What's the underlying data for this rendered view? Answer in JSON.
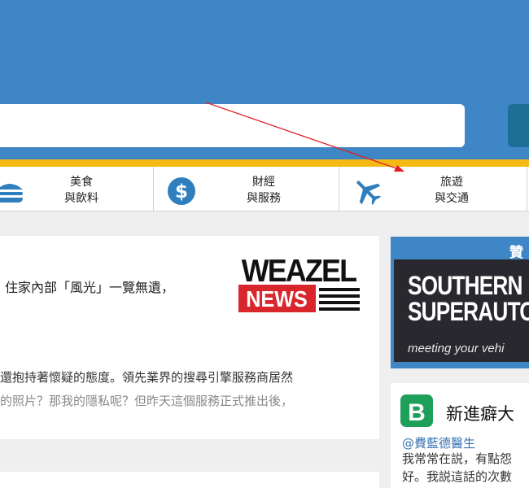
{
  "header": {
    "search": {
      "placeholder": "",
      "value": ""
    },
    "colors": {
      "header_bg": "#3e86c5",
      "accent_bar": "#f5b916",
      "search_button": "#1e6f97"
    }
  },
  "categories": [
    {
      "icon": "burger-icon",
      "line1": "美食",
      "line2": "與飲料"
    },
    {
      "icon": "dollar-icon",
      "line1": "財經",
      "line2": "與服務"
    },
    {
      "icon": "airplane-icon",
      "line1": "旅遊",
      "line2": "與交通"
    }
  ],
  "article": {
    "title": "住家內部「風光」一覽無遺，",
    "logo": {
      "line1": "WEAZEL",
      "line2": "NEWS"
    },
    "snippet": [
      "還抱持著懷疑的態度。領先業界的搜尋引擎服務商居然",
      "的照片？那我的隱私呢？但昨天這個服務正式推出後，"
    ]
  },
  "ad": {
    "label": "贊",
    "brand_line1": "SOUTHERN",
    "brand_line2": "SUPERAUTO",
    "tagline": "meeting your vehi"
  },
  "widget": {
    "logo_letter": "B",
    "title": "新進癖大",
    "author": "@費藍德醫生",
    "text": [
      "我常常在説，有點怨",
      "好。我説這話的次數"
    ]
  },
  "annotation": {
    "color": "#e02020"
  }
}
